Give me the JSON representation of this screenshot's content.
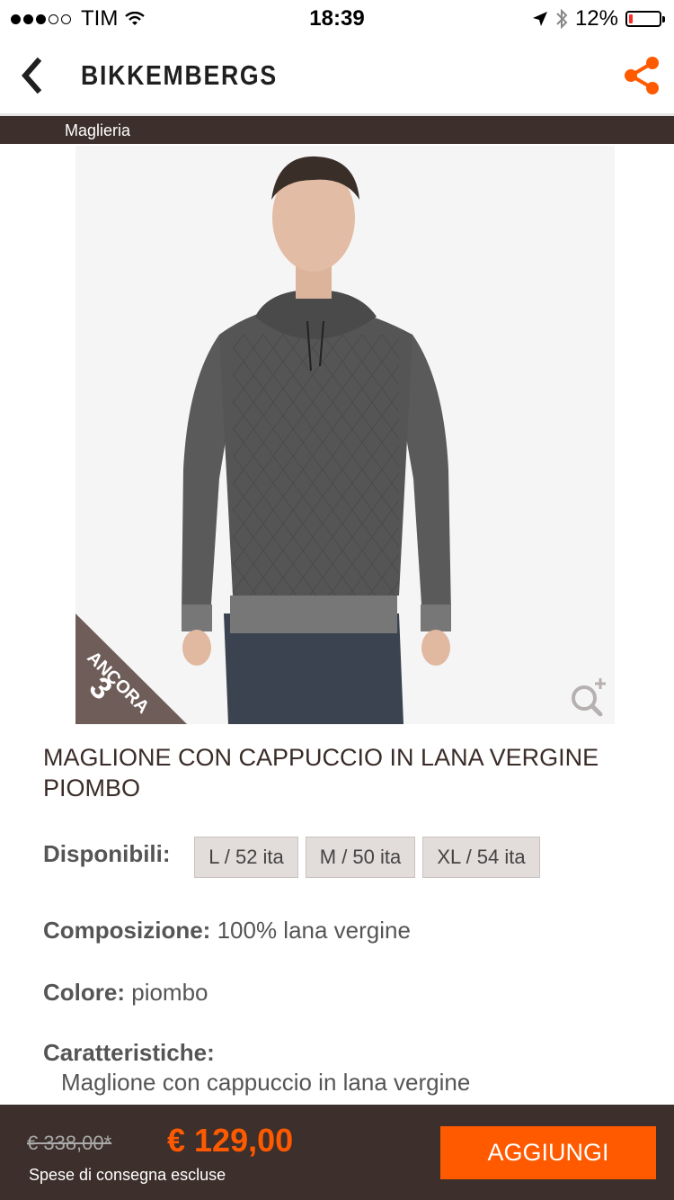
{
  "status_bar": {
    "carrier": "TIM",
    "time": "18:39",
    "battery": "12%"
  },
  "header": {
    "brand": "BIKKEMBERGS"
  },
  "category": {
    "label": "Maglieria"
  },
  "product": {
    "badge_line1": "ANCORA",
    "badge_count": "3",
    "title": "MAGLIONE CON CAPPUCCIO IN LANA VERGINE PIOMBO",
    "available_label": "Disponibili:",
    "sizes": [
      "L / 52 ita",
      "M / 50 ita",
      "XL / 54 ita"
    ],
    "composition_label": "Composizione:",
    "composition_value": "100% lana vergine",
    "color_label": "Colore:",
    "color_value": "piombo",
    "features_label": "Caratteristiche:",
    "features_value": "Maglione con cappuccio in lana vergine"
  },
  "purchase": {
    "old_price": "€ 338,00*",
    "price": "€ 129,00",
    "shipping_note": "Spese di consegna escluse",
    "add_button": "AGGIUNGI"
  },
  "colors": {
    "accent": "#ff5a00",
    "dark_brown": "#3d2f2b",
    "size_bg": "#e2dcdb"
  },
  "icons": [
    "signal-icon",
    "wifi-icon",
    "location-icon",
    "bluetooth-icon",
    "battery-icon",
    "back-chevron-icon",
    "share-icon",
    "zoom-icon"
  ]
}
